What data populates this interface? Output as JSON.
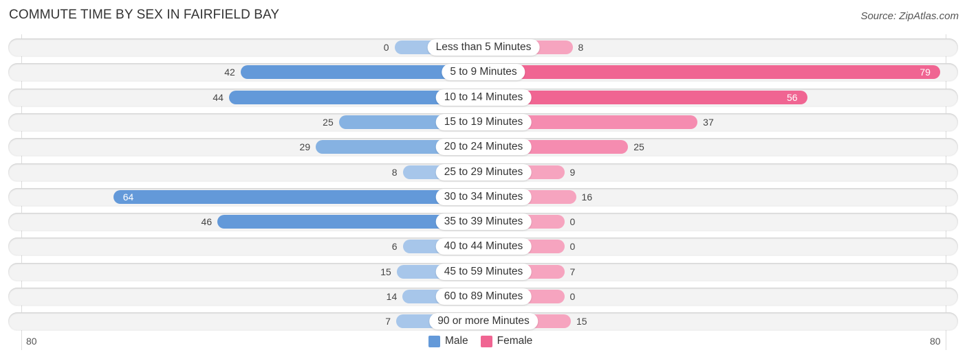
{
  "header": {
    "title": "COMMUTE TIME BY SEX IN FAIRFIELD BAY",
    "source": "Source: ZipAtlas.com"
  },
  "colors": {
    "male_strong": "#6399d9",
    "male_light": "#a7c6ea",
    "female_strong": "#f06592",
    "female_light": "#f6a4bf"
  },
  "chart_data": {
    "type": "bar",
    "orientation": "horizontal-diverging",
    "title": "COMMUTE TIME BY SEX IN FAIRFIELD BAY",
    "categories": [
      "Less than 5 Minutes",
      "5 to 9 Minutes",
      "10 to 14 Minutes",
      "15 to 19 Minutes",
      "20 to 24 Minutes",
      "25 to 29 Minutes",
      "30 to 34 Minutes",
      "35 to 39 Minutes",
      "40 to 44 Minutes",
      "45 to 59 Minutes",
      "60 to 89 Minutes",
      "90 or more Minutes"
    ],
    "series": [
      {
        "name": "Male",
        "side": "left",
        "values": [
          0,
          42,
          44,
          25,
          29,
          8,
          64,
          46,
          6,
          15,
          14,
          7
        ]
      },
      {
        "name": "Female",
        "side": "right",
        "values": [
          8,
          79,
          56,
          37,
          25,
          9,
          16,
          0,
          0,
          7,
          0,
          15
        ]
      }
    ],
    "axis": {
      "min_label": "80",
      "max_label": "80",
      "range": [
        -80,
        80
      ]
    },
    "legend": {
      "position": "bottom-center",
      "entries": [
        "Male",
        "Female"
      ]
    }
  }
}
